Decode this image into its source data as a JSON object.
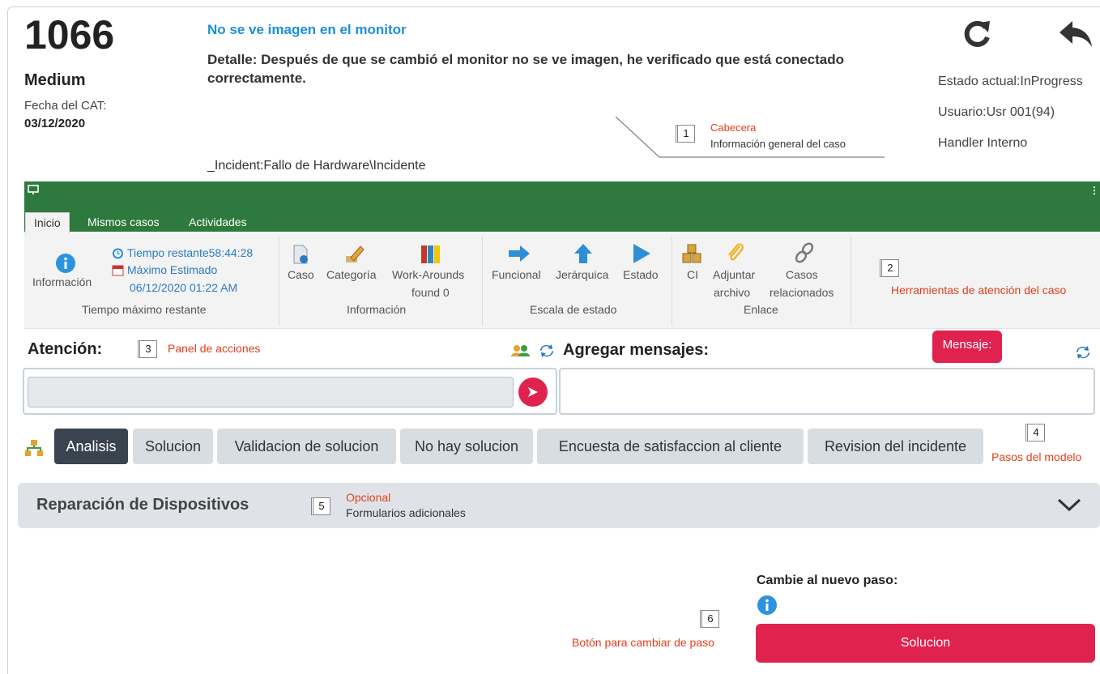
{
  "header": {
    "case_number": "1066",
    "priority": "Medium",
    "cat_date_label": "Fecha del CAT:",
    "cat_date": "03/12/2020",
    "title": "No se ve imagen en el monitor",
    "detail": "Detalle: Después de que se cambió el monitor no se ve imagen, he verificado que está conectado correctamente.",
    "path": "_Incident:Fallo de Hardware\\Incidente",
    "state": "Estado actual:InProgress",
    "user": "Usuario:Usr 001(94)",
    "handler": "Handler Interno",
    "icons": [
      "refresh-icon",
      "back-arrow-icon"
    ]
  },
  "callouts": [
    {
      "number": "1",
      "title": "Cabecera",
      "subtitle": "Información general del caso"
    },
    {
      "number": "2",
      "title": "Herramientas de atención del caso",
      "subtitle": ""
    },
    {
      "number": "3",
      "title": "Panel de acciones",
      "subtitle": ""
    },
    {
      "number": "4",
      "title": "Pasos del modelo",
      "subtitle": ""
    },
    {
      "number": "5",
      "title": "Opcional",
      "subtitle": "Formularios adicionales"
    },
    {
      "number": "6",
      "title": "Botón para cambiar de paso",
      "subtitle": ""
    }
  ],
  "tabs": [
    {
      "label": "Inicio",
      "active": true
    },
    {
      "label": "Mismos casos",
      "active": false
    },
    {
      "label": "Actividades",
      "active": false
    }
  ],
  "ribbon": {
    "time_group": {
      "info_label": "Información",
      "remaining": "Tiempo restante58:44:28",
      "max_estimated_label": "Máximo Estimado",
      "max_estimated_date": "06/12/2020 01:22 AM",
      "group_label": "Tiempo máximo restante"
    },
    "info_group": {
      "caso": "Caso",
      "categoria": "Categoría",
      "workarounds_1": "Work-Arounds",
      "workarounds_2": "found 0",
      "group_label": "Información"
    },
    "escala_group": {
      "funcional": "Funcional",
      "jerarquica": "Jerárquica",
      "estado": "Estado",
      "group_label": "Escala de estado"
    },
    "enlace_group": {
      "ci": "CI",
      "adjuntar_1": "Adjuntar",
      "adjuntar_2": "archivo",
      "casos_1": "Casos",
      "casos_2": "relacionados",
      "group_label": "Enlace"
    }
  },
  "actions": {
    "attention_title": "Atención:",
    "messages_title": "Agregar mensajes:",
    "message_button": "Mensaje:"
  },
  "steps": [
    {
      "label": "Analisis",
      "active": true
    },
    {
      "label": "Solucion",
      "active": false
    },
    {
      "label": "Validacion de solucion",
      "active": false
    },
    {
      "label": "No hay solucion",
      "active": false
    },
    {
      "label": "Encuesta de satisfaccion al cliente",
      "active": false
    },
    {
      "label": "Revision del incidente",
      "active": false
    }
  ],
  "form": {
    "title": "Reparación de Dispositivos"
  },
  "change_step": {
    "label": "Cambie al nuevo paso:",
    "button": "Solucion"
  },
  "colors": {
    "brand_green": "#2e7a3e",
    "accent_red": "#e0224f",
    "link_blue": "#1a8fd8",
    "step_active": "#39444f"
  }
}
